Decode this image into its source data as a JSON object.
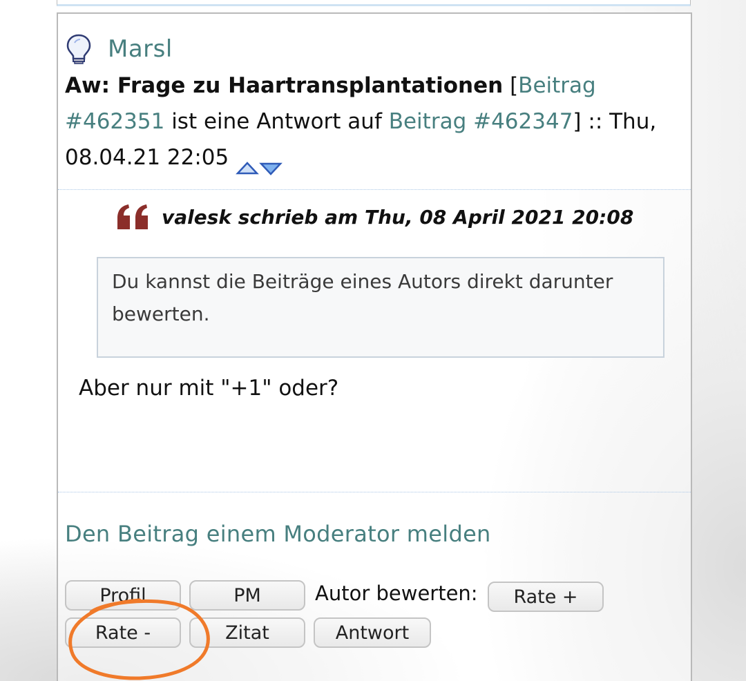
{
  "post": {
    "author": "Marsl",
    "title": "Aw: Frage zu Haartransplantationen",
    "bracket_open": "[",
    "post_ref": "Beitrag #462351",
    "reply_to_text": "ist eine Antwort auf",
    "parent_ref": "Beitrag #462347",
    "meta_suffix": "] :: Thu, 08.04.21 22:05",
    "quote_author_line": "valesk schrieb am Thu, 08 April 2021 20:08",
    "quote_text": "Du kannst die Beiträge eines Autors direkt darunter bewerten.",
    "reply_text": "Aber nur mit \"+1\" oder?",
    "report_link": "Den Beitrag einem Moderator melden"
  },
  "buttons": {
    "profil": "Profil",
    "pm": "PM",
    "rate_label": "Autor bewerten:",
    "rate_plus": "Rate +",
    "rate_minus": "Rate -",
    "zitat": "Zitat",
    "antwort": "Antwort"
  },
  "icons": {
    "author_status": "lightbulb-icon",
    "quote": "quote-mark-icon",
    "nav_up": "arrow-up-icon",
    "nav_down": "arrow-down-icon"
  },
  "colors": {
    "link": "#477f7f",
    "quote_mark": "#8b2e2a",
    "annotation": "#f07a2a"
  }
}
